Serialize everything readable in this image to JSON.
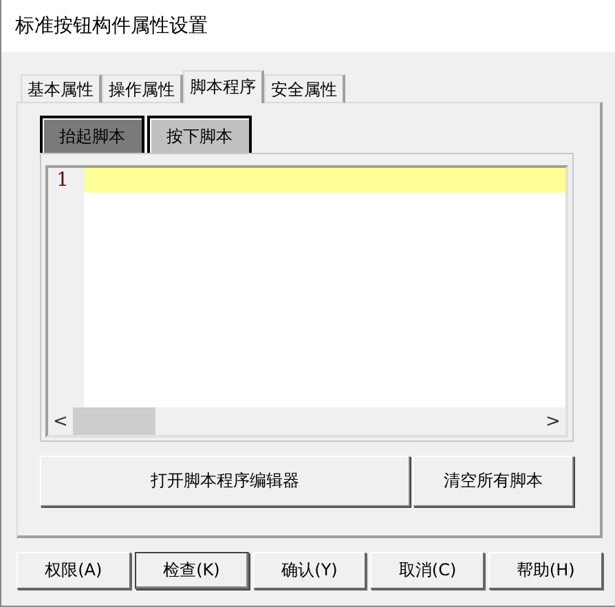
{
  "window": {
    "title": "标准按钮构件属性设置"
  },
  "tabs": [
    {
      "label": "基本属性",
      "selected": false
    },
    {
      "label": "操作属性",
      "selected": false
    },
    {
      "label": "脚本程序",
      "selected": true
    },
    {
      "label": "安全属性",
      "selected": false
    }
  ],
  "script_tabs": [
    {
      "label": "抬起脚本",
      "selected": true
    },
    {
      "label": "按下脚本",
      "selected": false
    }
  ],
  "editor": {
    "line_numbers": [
      "1"
    ],
    "scrollbar": {
      "left_arrow": "<",
      "right_arrow": ">"
    }
  },
  "actions": [
    "打开脚本程序编辑器",
    "清空所有脚本"
  ],
  "buttons": [
    {
      "label": "权限(A)",
      "focused": false
    },
    {
      "label": "检查(K)",
      "focused": true
    },
    {
      "label": "确认(Y)",
      "focused": false
    },
    {
      "label": "取消(C)",
      "focused": false
    },
    {
      "label": "帮助(H)",
      "focused": false
    }
  ]
}
